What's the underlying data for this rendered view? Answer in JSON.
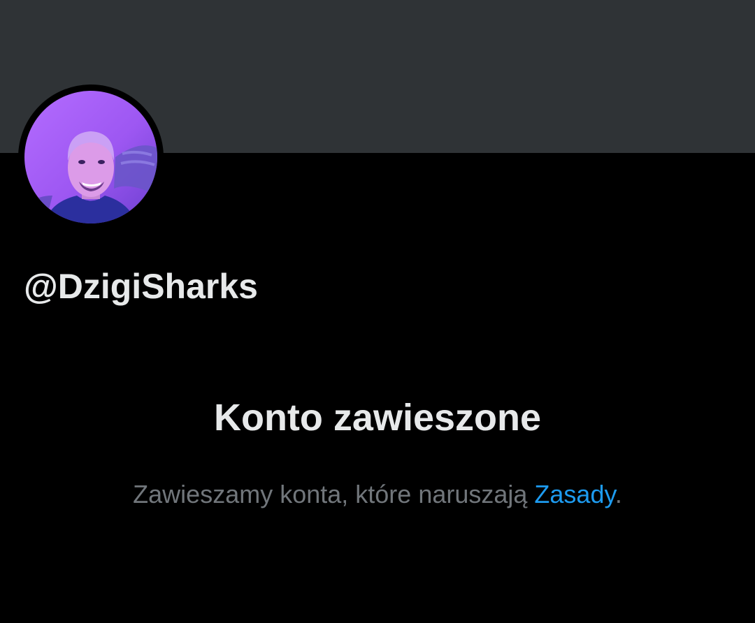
{
  "profile": {
    "handle": "@DzigiSharks",
    "avatar_icon": "profile-photo"
  },
  "suspension": {
    "title": "Konto zawieszone",
    "message": "Zawieszamy konta, które naruszają ",
    "link_label": "Zasady",
    "suffix": "."
  },
  "colors": {
    "background": "#000000",
    "banner": "#2f3336",
    "primary_text": "#e7e9ea",
    "secondary_text": "#71767b",
    "link": "#1d9bf0"
  }
}
